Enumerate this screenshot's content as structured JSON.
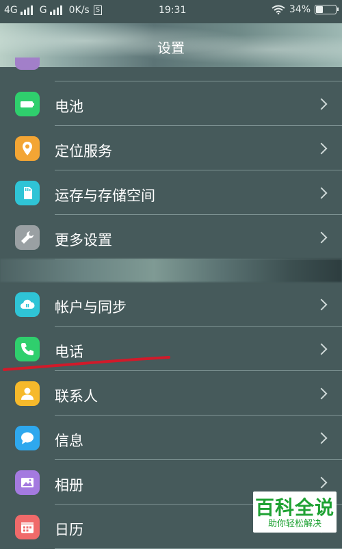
{
  "status_bar": {
    "net1": "4G",
    "net2": "G",
    "speed": "0K/s",
    "s_badge": "S",
    "time": "19:31",
    "battery_text": "34%",
    "battery_level": 0.34
  },
  "header": {
    "title": "设置"
  },
  "settings_group1": [
    {
      "label": "电池",
      "icon": "battery-icon",
      "color": "#2fcf6d"
    },
    {
      "label": "定位服务",
      "icon": "location-pin-icon",
      "color": "#f3a534"
    },
    {
      "label": "运存与存储空间",
      "icon": "sd-card-icon",
      "color": "#2fc4d6"
    },
    {
      "label": "更多设置",
      "icon": "wrench-icon",
      "color": "#9aa0a3"
    }
  ],
  "settings_group2": [
    {
      "label": "帐户与同步",
      "icon": "cloud-sync-icon",
      "color": "#2fc4d6"
    },
    {
      "label": "电话",
      "icon": "phone-icon",
      "color": "#2fcf6d"
    },
    {
      "label": "联系人",
      "icon": "contact-icon",
      "color": "#f6b92b"
    },
    {
      "label": "信息",
      "icon": "message-icon",
      "color": "#2ea8ee"
    },
    {
      "label": "相册",
      "icon": "photo-album-icon",
      "color": "#a47ae0"
    },
    {
      "label": "日历",
      "icon": "calendar-icon",
      "color": "#f06a6a"
    }
  ],
  "watermark": {
    "title": "百科全说",
    "subtitle": "助你轻松解决"
  }
}
